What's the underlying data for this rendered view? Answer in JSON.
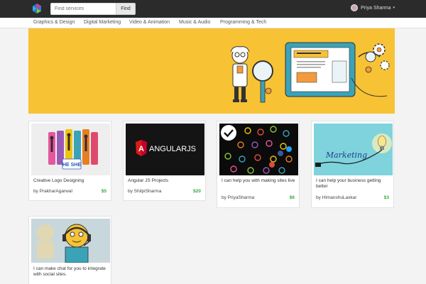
{
  "search": {
    "placeholder": "Find services",
    "button_label": "Find"
  },
  "user": {
    "name": "Priya Sharma",
    "caret": "▾"
  },
  "categories": [
    {
      "label": "Graphics & Design"
    },
    {
      "label": "Digital Marketing"
    },
    {
      "label": "Video & Animation"
    },
    {
      "label": "Music & Audio"
    },
    {
      "label": "Programming & Tech"
    }
  ],
  "colors": {
    "topbar": "#2b2b2b",
    "banner": "#f7c234",
    "price": "#3aa83f"
  },
  "gigs": [
    {
      "title": "Creative Logo Designing",
      "author": "by PrakharAgarwal",
      "price": "$5",
      "image": "he-she-logo-thumbnail",
      "badge": "HE SHE"
    },
    {
      "title": "Angular JS Projects",
      "author": "by ShilpiSharma",
      "price": "$20",
      "image": "angularjs-logo-thumbnail",
      "logo_text": "ANGULARJS"
    },
    {
      "title": "I can help you with making sites live",
      "author": "by PriyaSharma",
      "price": "$6",
      "image": "social-icons-thumbnail"
    },
    {
      "title": "I can help your business getting better",
      "author": "by HimanshuLaxkar",
      "price": "$3",
      "image": "marketing-bulb-thumbnail",
      "script_text": "Marketing"
    },
    {
      "title": "I can make chat for you to integrate with social sites.",
      "author": "",
      "price": "",
      "image": "chat-support-thumbnail"
    }
  ]
}
